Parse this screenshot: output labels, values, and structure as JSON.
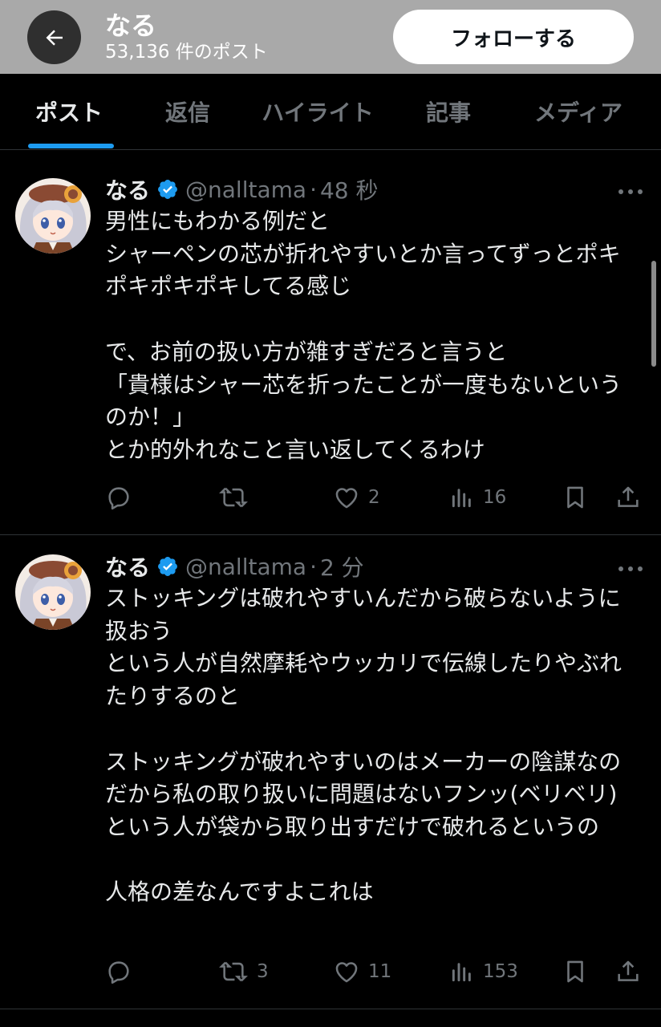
{
  "header": {
    "name": "なる",
    "post_count": "53,136 件のポスト",
    "follow_label": "フォローする"
  },
  "tabs": [
    {
      "label": "ポスト",
      "active": true
    },
    {
      "label": "返信",
      "active": false
    },
    {
      "label": "ハイライト",
      "active": false
    },
    {
      "label": "記事",
      "active": false
    },
    {
      "label": "メディア",
      "active": false
    }
  ],
  "colors": {
    "accent": "#1d9bf0",
    "muted": "#71767b",
    "background": "#000000"
  },
  "posts": [
    {
      "name": "なる",
      "verified": true,
      "handle": "@nalltama",
      "separator": "·",
      "time": "48 秒",
      "text": "男性にもわかる例だと\nシャーペンの芯が折れやすいとか言ってずっとポキポキポキポキしてる感じ\n\nで、お前の扱い方が雑すぎだろと言うと\n「貴様はシャー芯を折ったことが一度もないというのか！」\nとか的外れなこと言い返してくるわけ",
      "replies": "",
      "reposts": "",
      "likes": "2",
      "views": "16"
    },
    {
      "name": "なる",
      "verified": true,
      "handle": "@nalltama",
      "separator": "·",
      "time": "2 分",
      "text": "ストッキングは破れやすいんだから破らないように扱おう\nという人が自然摩耗やウッカリで伝線したりやぶれたりするのと\n\nストッキングが破れやすいのはメーカーの陰謀なのだから私の取り扱いに問題はないフンッ(ベリベリ)\nという人が袋から取り出すだけで破れるというの\n\n人格の差なんですよこれは",
      "replies": "",
      "reposts": "3",
      "likes": "11",
      "views": "153"
    }
  ]
}
